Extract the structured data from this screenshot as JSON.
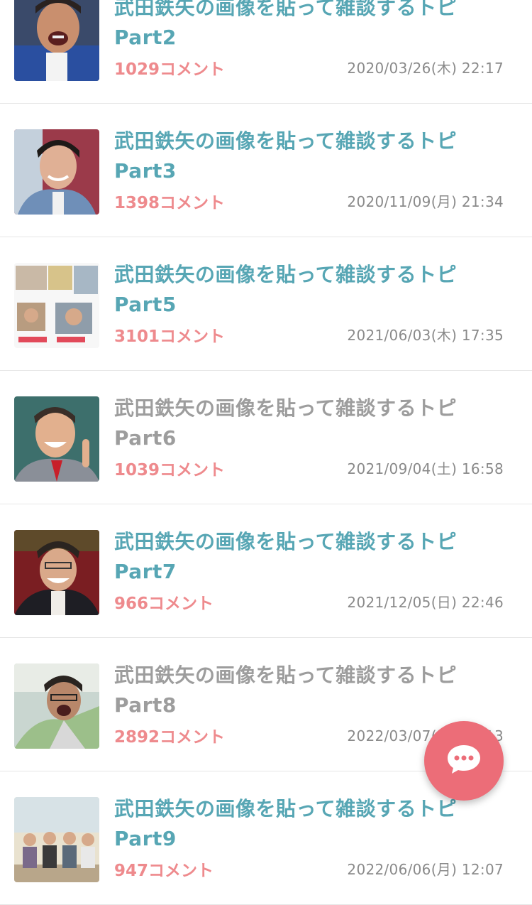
{
  "topics": [
    {
      "title": "武田鉄矢の画像を貼って雑談するトピ",
      "part": "Part2",
      "comments": "1029コメント",
      "date": "2020/03/26(木) 22:17",
      "read": false,
      "thumb": "crying-man"
    },
    {
      "title": "武田鉄矢の画像を貼って雑談するトピ",
      "part": "Part3",
      "comments": "1398コメント",
      "date": "2020/11/09(月) 21:34",
      "read": false,
      "thumb": "smiling-man"
    },
    {
      "title": "武田鉄矢の画像を貼って雑談するトピ",
      "part": "Part5",
      "comments": "3101コメント",
      "date": "2021/06/03(木) 17:35",
      "read": false,
      "thumb": "screenshot-collage"
    },
    {
      "title": "武田鉄矢の画像を貼って雑談するトピ",
      "part": "Part6",
      "comments": "1039コメント",
      "date": "2021/09/04(土) 16:58",
      "read": true,
      "thumb": "pointing-man"
    },
    {
      "title": "武田鉄矢の画像を貼って雑談するトピ",
      "part": "Part7",
      "comments": "966コメント",
      "date": "2021/12/05(日) 22:46",
      "read": false,
      "thumb": "laughing-man"
    },
    {
      "title": "武田鉄矢の画像を貼って雑談するトピ",
      "part": "Part8",
      "comments": "2892コメント",
      "date": "2022/03/07(月) 21:13",
      "read": true,
      "thumb": "shouting-man"
    },
    {
      "title": "武田鉄矢の画像を貼って雑談するトピ",
      "part": "Part9",
      "comments": "947コメント",
      "date": "2022/06/06(月) 12:07",
      "read": false,
      "thumb": "tv-studio"
    }
  ],
  "fab": {
    "icon": "chat-bubble-icon",
    "color": "#ec6d78"
  },
  "colors": {
    "unread_title": "#57a6b4",
    "read_title": "#9d9d9d",
    "comments": "#ee8a8d"
  }
}
